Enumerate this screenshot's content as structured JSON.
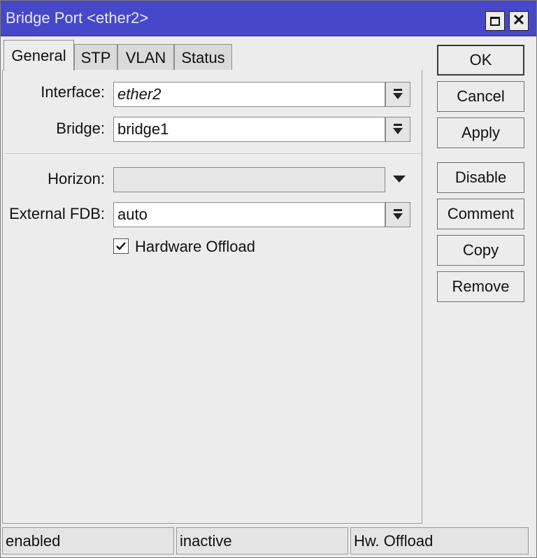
{
  "window": {
    "title": "Bridge Port <ether2>"
  },
  "tabs": [
    {
      "label": "General",
      "active": true
    },
    {
      "label": "STP",
      "active": false
    },
    {
      "label": "VLAN",
      "active": false
    },
    {
      "label": "Status",
      "active": false
    }
  ],
  "form": {
    "interface": {
      "label": "Interface:",
      "value": "ether2"
    },
    "bridge": {
      "label": "Bridge:",
      "value": "bridge1"
    },
    "horizon": {
      "label": "Horizon:",
      "value": ""
    },
    "external_fdb": {
      "label": "External FDB:",
      "value": "auto"
    },
    "hardware_offload": {
      "label": "Hardware Offload",
      "checked": true
    }
  },
  "buttons": {
    "ok": "OK",
    "cancel": "Cancel",
    "apply": "Apply",
    "disable": "Disable",
    "comment": "Comment",
    "copy": "Copy",
    "remove": "Remove"
  },
  "status": {
    "enabled": "enabled",
    "inactive": "inactive",
    "hw_offload": "Hw. Offload"
  },
  "icons": {
    "dropdown": "dropdown-arrow-icon",
    "maximize": "maximize-icon",
    "close": "close-icon",
    "check": "checkmark-icon"
  },
  "colors": {
    "title_bar": "#4747c9",
    "title_text": "#e8e8ff",
    "window_bg": "#ececec"
  }
}
